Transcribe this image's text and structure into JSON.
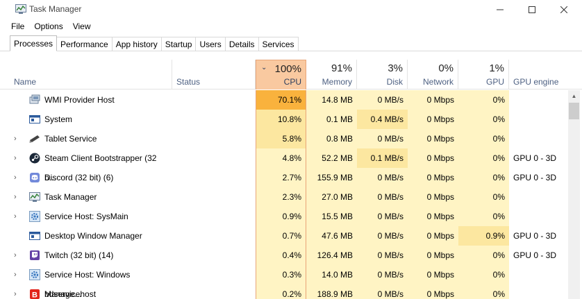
{
  "window": {
    "title": "Task Manager"
  },
  "menu": [
    "File",
    "Options",
    "View"
  ],
  "tabs": [
    "Processes",
    "Performance",
    "App history",
    "Startup",
    "Users",
    "Details",
    "Services"
  ],
  "columns": {
    "name": "Name",
    "status": "Status",
    "cpu": {
      "label": "CPU",
      "pct": "100%"
    },
    "memory": {
      "label": "Memory",
      "pct": "91%"
    },
    "disk": {
      "label": "Disk",
      "pct": "3%"
    },
    "network": {
      "label": "Network",
      "pct": "0%"
    },
    "gpu": {
      "label": "GPU",
      "pct": "1%"
    },
    "gpu_engine": "GPU engine"
  },
  "processes": [
    {
      "name": "WMI Provider Host",
      "icon": "wmi-icon",
      "expandable": false,
      "cpu": "70.1%",
      "cpu_level": 3,
      "mem": "14.8 MB",
      "disk": "0 MB/s",
      "net": "0 Mbps",
      "gpu": "0%",
      "engine": ""
    },
    {
      "name": "System",
      "icon": "system-window-icon",
      "expandable": false,
      "cpu": "10.8%",
      "cpu_level": 2,
      "mem": "0.1 MB",
      "disk": "0.4 MB/s",
      "net": "0 Mbps",
      "gpu": "0%",
      "engine": ""
    },
    {
      "name": "Tablet Service",
      "icon": "tablet-pen-icon",
      "expandable": true,
      "cpu": "5.8%",
      "cpu_level": 2,
      "mem": "0.8 MB",
      "disk": "0 MB/s",
      "net": "0 Mbps",
      "gpu": "0%",
      "engine": ""
    },
    {
      "name": "Steam Client Bootstrapper (32 b...",
      "icon": "steam-icon",
      "expandable": true,
      "cpu": "4.8%",
      "cpu_level": 1,
      "mem": "52.2 MB",
      "disk": "0.1 MB/s",
      "net": "0 Mbps",
      "gpu": "0%",
      "engine": "GPU 0 - 3D"
    },
    {
      "name": "Discord (32 bit) (6)",
      "icon": "discord-icon",
      "expandable": true,
      "cpu": "2.7%",
      "cpu_level": 1,
      "mem": "155.9 MB",
      "disk": "0 MB/s",
      "net": "0 Mbps",
      "gpu": "0%",
      "engine": "GPU 0 - 3D"
    },
    {
      "name": "Task Manager",
      "icon": "task-manager-icon",
      "expandable": true,
      "cpu": "2.3%",
      "cpu_level": 1,
      "mem": "27.0 MB",
      "disk": "0 MB/s",
      "net": "0 Mbps",
      "gpu": "0%",
      "engine": ""
    },
    {
      "name": "Service Host: SysMain",
      "icon": "gear-icon",
      "expandable": true,
      "cpu": "0.9%",
      "cpu_level": 1,
      "mem": "15.5 MB",
      "disk": "0 MB/s",
      "net": "0 Mbps",
      "gpu": "0%",
      "engine": ""
    },
    {
      "name": "Desktop Window Manager",
      "icon": "system-window-icon",
      "expandable": false,
      "cpu": "0.7%",
      "cpu_level": 1,
      "mem": "47.6 MB",
      "disk": "0 MB/s",
      "net": "0 Mbps",
      "gpu": "0.9%",
      "engine": "GPU 0 - 3D"
    },
    {
      "name": "Twitch (32 bit) (14)",
      "icon": "twitch-icon",
      "expandable": true,
      "cpu": "0.4%",
      "cpu_level": 1,
      "mem": "126.4 MB",
      "disk": "0 MB/s",
      "net": "0 Mbps",
      "gpu": "0%",
      "engine": "GPU 0 - 3D"
    },
    {
      "name": "Service Host: Windows Manage...",
      "icon": "gear-icon",
      "expandable": true,
      "cpu": "0.3%",
      "cpu_level": 1,
      "mem": "14.0 MB",
      "disk": "0 MB/s",
      "net": "0 Mbps",
      "gpu": "0%",
      "engine": ""
    },
    {
      "name": "bdservicehost",
      "icon": "bitdefender-icon",
      "expandable": true,
      "cpu": "0.2%",
      "cpu_level": 1,
      "mem": "188.9 MB",
      "disk": "0 MB/s",
      "net": "0 Mbps",
      "gpu": "0%",
      "engine": ""
    }
  ],
  "colors": {
    "cpu_header": "#f9c9a0",
    "heat_1": "#fff4c4",
    "heat_2": "#fce7a0",
    "heat_3": "#f9b23d",
    "header_label": "#4d6082"
  }
}
